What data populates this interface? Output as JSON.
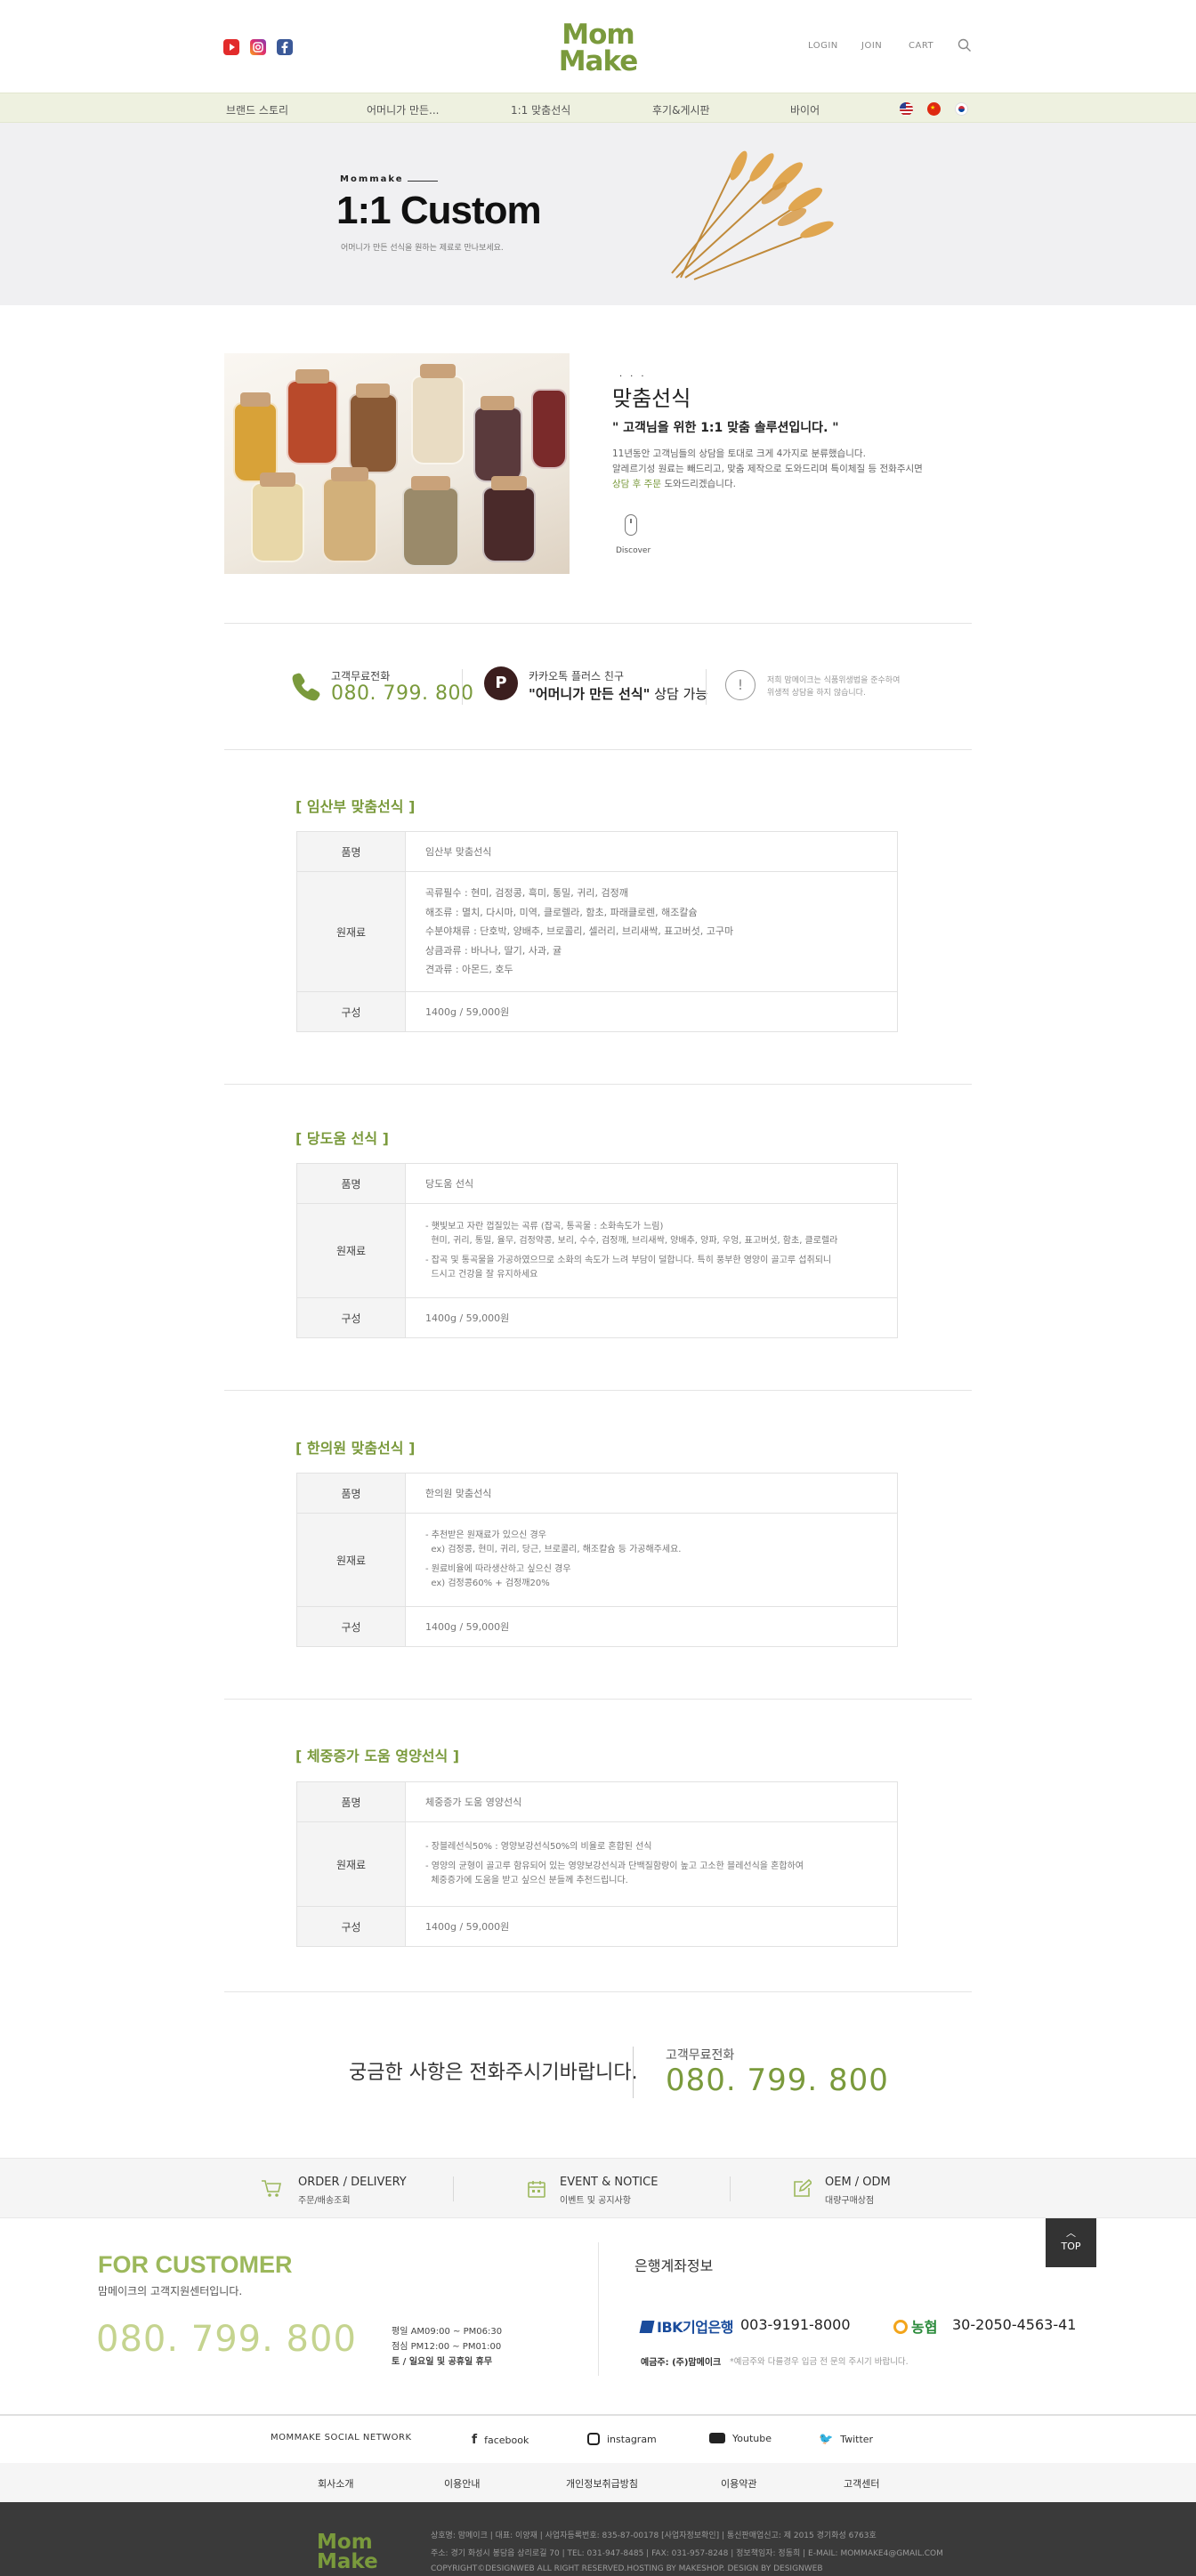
{
  "header": {
    "logo_line1": "Mom",
    "logo_line2": "Make",
    "util": [
      "LOGIN",
      "JOIN",
      "CART"
    ],
    "search_icon": "search-icon",
    "sns_icons": [
      "youtube-icon",
      "instagram-icon",
      "facebook-icon"
    ]
  },
  "nav": {
    "items": [
      "브랜드 스토리",
      "어머니가 만든...",
      "1:1 맞춤선식",
      "후기&게시판",
      "바이어"
    ],
    "flags": [
      "flag-us-icon",
      "flag-cn-icon",
      "flag-kr-icon"
    ]
  },
  "hero": {
    "brand": "Mommake",
    "title": "1:1 Custom",
    "desc": "어머니가 만든 선식을 원하는 제료로 만나보세요."
  },
  "intro": {
    "dots": "···",
    "title": "맞춤선식",
    "quote": "\" 고객님을 위한 1:1 맞춤 솔루션입니다. \"",
    "p1": "11년동안 고객님들의 상담을 토대로 크게 4가지로 분류했습니다.",
    "p2": "알레르기성 원료는 빼드리고, 맞춤 제작으로 도와드리며 특이체질 등 전화주시면",
    "p3_green": "상담 후 주문",
    "p3_rest": " 도와드리겠습니다.",
    "discover": "Discover"
  },
  "contact_bar": {
    "phone_label": "고객무료전화",
    "phone_number": "080. 799. 800",
    "kakao_logo": "P",
    "kakao_label": "카카오톡 플러스 친구",
    "kakao_title": "\"어머니가 만든 선식\"",
    "kakao_title_suffix": " 상담 가능",
    "notice_icon": "!",
    "notice_line1": "저희 맘메이크는 식품위생법을 준수하여",
    "notice_line2": "위생적 상담을 하지 않습니다."
  },
  "products": [
    {
      "title": "[ 임산부 맞춤선식 ]",
      "rows": {
        "name_label": "품명",
        "name_value": "임산부 맞춤선식",
        "ingredients_label": "원재료",
        "ingredients": [
          "곡류필수 : 현미, 검정콩, 흑미, 통밀, 귀리, 검정깨",
          "해조류 : 멸치, 다시마, 미역, 클로렐라, 함초, 파래클로렌, 해조칼슘",
          "수분야채류 : 단호박, 양배추, 브로콜리, 셀러리, 브리새싹, 표고버섯, 고구마",
          "상큼과류 : 바나나, 딸기, 사과, 귤",
          "견과류 : 아몬드, 호두"
        ],
        "composition_label": "구성",
        "composition_value": "1400g / 59,000원"
      }
    },
    {
      "title": "[ 당도움 선식 ]",
      "rows": {
        "name_label": "품명",
        "name_value": "당도움 선식",
        "ingredients_label": "원재료",
        "ingredients": [
          "- 햇빛보고 자란 껍질있는 곡류 (잡곡, 통곡물 : 소화속도가 느림)",
          "  현미, 귀리, 통밀, 율무, 검정약콩, 보리, 수수, 검정깨, 브리새싹, 양배추, 양파, 우엉, 표고버섯, 함초, 클로렐라",
          "- 잡곡 및 통곡물을 가공하였으므로 소화의 속도가 느려 부담이 덜합니다. 특히 풍부한 영양이 골고루 섭취되니",
          "  드시고 건강을 잘 유지하세요"
        ],
        "composition_label": "구성",
        "composition_value": "1400g / 59,000원"
      }
    },
    {
      "title": "[ 한의원 맞춤선식 ]",
      "rows": {
        "name_label": "품명",
        "name_value": "한의원 맞춤선식",
        "ingredients_label": "원재료",
        "ingredients": [
          "- 추천받은 원재료가 있으신 경우",
          "  ex) 검정콩, 현미, 귀리, 당근, 브로콜리, 해조칼슘 등 가공해주세요.",
          "- 원료비율에 따라생산하고 싶으신 경우",
          "  ex) 검정콩60% + 검정깨20%"
        ],
        "composition_label": "구성",
        "composition_value": "1400g / 59,000원"
      }
    },
    {
      "title": "[ 체중증가 도움 영양선식 ]",
      "rows": {
        "name_label": "품명",
        "name_value": "체중증가 도움 영양선식",
        "ingredients_label": "원재료",
        "ingredients": [
          "- 장블레선식50% : 영양보강선식50%의 비율로 혼합된 선식",
          "- 영양의 균형이 골고루 함유되어 있는 영양보강선식과 단백질함량이 높고 고소한 블레선식을 혼합하여",
          "  체중증가에 도움을 받고 싶으신 분들께 추천드립니다."
        ],
        "composition_label": "구성",
        "composition_value": "1400g / 59,000원"
      }
    }
  ],
  "call": {
    "question": "궁금한 사항은 전화주시기바랍니다.",
    "label": "고객무료전화",
    "number": "080. 799. 800"
  },
  "quick": [
    {
      "icon": "cart-icon",
      "title": "ORDER / DELIVERY",
      "sub": "주문/배송조회"
    },
    {
      "icon": "calendar-icon",
      "title": "EVENT & NOTICE",
      "sub": "이벤트 및 공지사항"
    },
    {
      "icon": "edit-icon",
      "title": "OEM / ODM",
      "sub": "대량구매상점"
    }
  ],
  "customer": {
    "title": "FOR CUSTOMER",
    "sub": "맘메이크의 고객지원센터입니다.",
    "number": "080. 799. 800",
    "hours": [
      "평일  AM09:00 ~ PM06:30",
      "점심  PM12:00 ~ PM01:00",
      "토 / 일요일 및 공휴일 휴무"
    ]
  },
  "bank": {
    "title": "은행계좌정보",
    "ibk_name": "IBK기업은행",
    "ibk_number": "003-9191-8000",
    "nh_name": "농협",
    "nh_number": "30-2050-4563-41",
    "owner_label": "예금주: (주)맘메이크",
    "owner_note": "*예금주와 다를경우 입금 전 문의 주시기 바랍니다."
  },
  "top_button": "TOP",
  "social": {
    "label": "MOMMAKE SOCIAL NETWORK",
    "items": [
      "facebook",
      "instagram",
      "Youtube",
      "Twitter"
    ]
  },
  "footer_nav": [
    "회사소개",
    "이용안내",
    "개인정보취급방침",
    "이용약관",
    "고객센터"
  ],
  "footer": {
    "logo_line1": "Mom",
    "logo_line2": "Make",
    "info1": "상호명: 맘메이크 | 대표: 이양재 | 사업자등록번호: 835-87-00178 [사업자정보확인] | 통신판매업신고: 제 2015 경기화성 6763호",
    "info2": "주소: 경기 화성시 봉담읍 상리로길 70 | TEL: 031-947-8485 | FAX: 031-957-8248 | 정보책임자: 정동희 | E-MAIL: MOMMAKE4@GMAIL.COM",
    "info3": "COPYRIGHT©DESIGNWEB ALL RIGHT RESERVED.HOSTING BY MAKESHOP. DESIGN BY DESIGNWEB"
  },
  "colors": {
    "accent": "#7a9a3c",
    "accent_light": "#9cb85c",
    "nav_bg": "#eef1e0",
    "hero_bg": "#f0f0f2",
    "footer_bg": "#3a3a3a"
  }
}
